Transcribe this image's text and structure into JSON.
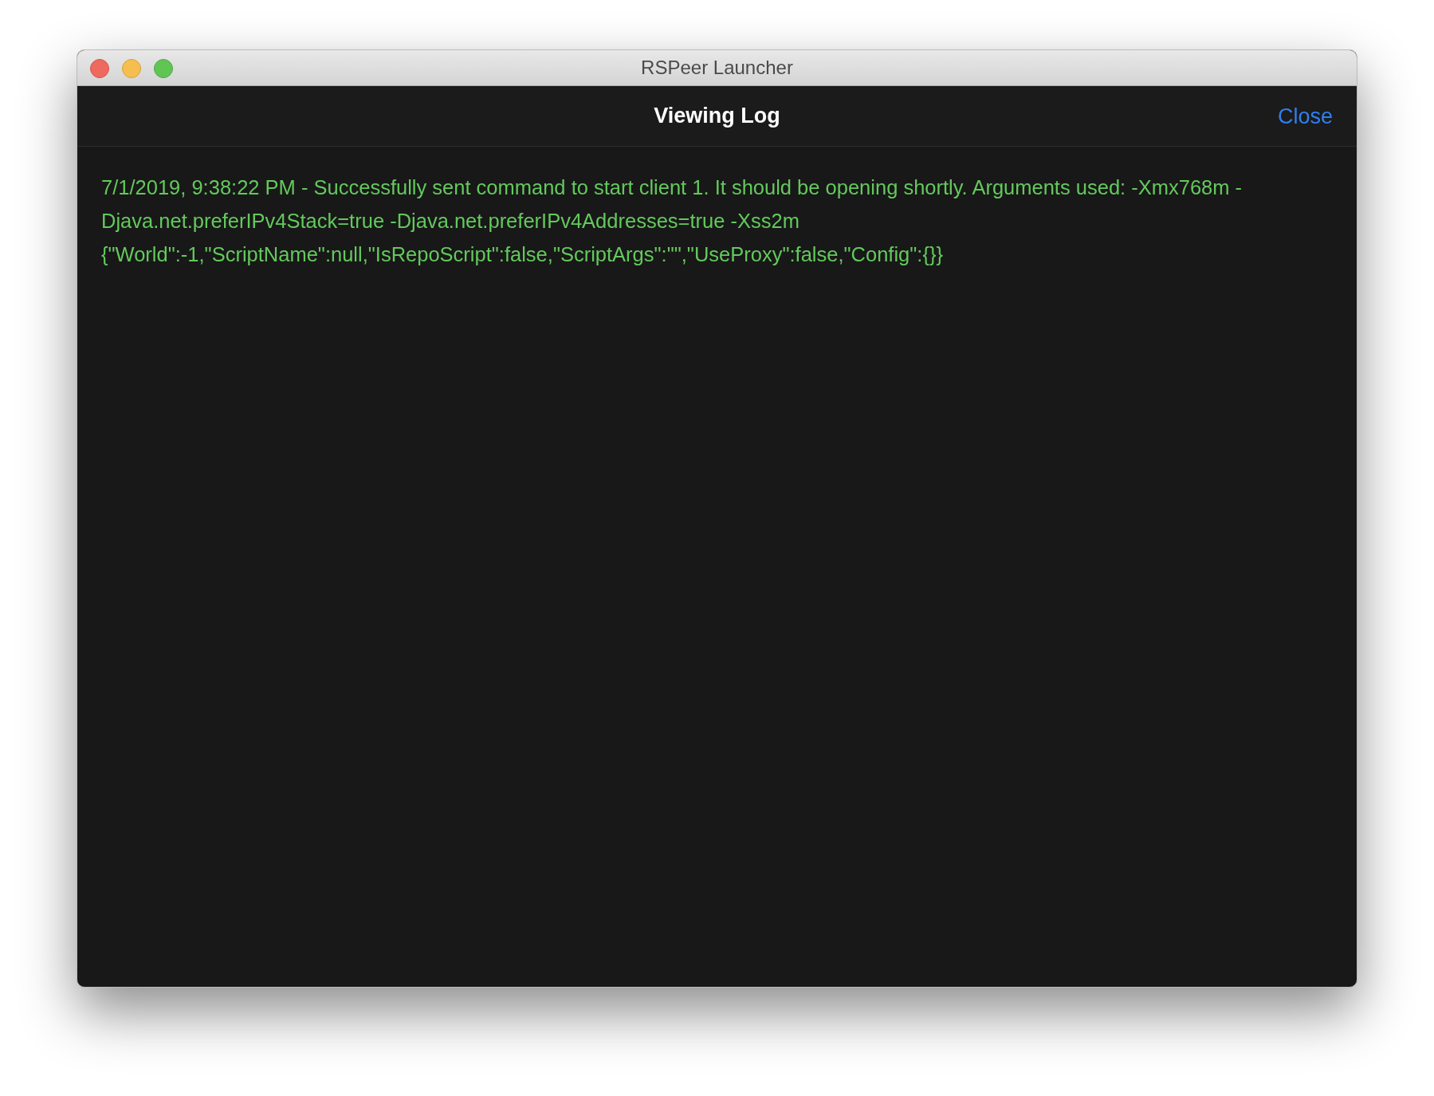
{
  "window": {
    "title": "RSPeer Launcher"
  },
  "header": {
    "title": "Viewing Log",
    "close_label": "Close"
  },
  "log": {
    "entries": [
      "7/1/2019, 9:38:22 PM - Successfully sent command to start client 1. It should be opening shortly. Arguments used: -Xmx768m -Djava.net.preferIPv4Stack=true -Djava.net.preferIPv4Addresses=true -Xss2m {\"World\":-1,\"ScriptName\":null,\"IsRepoScript\":false,\"ScriptArgs\":\"\",\"UseProxy\":false,\"Config\":{}}"
    ]
  }
}
